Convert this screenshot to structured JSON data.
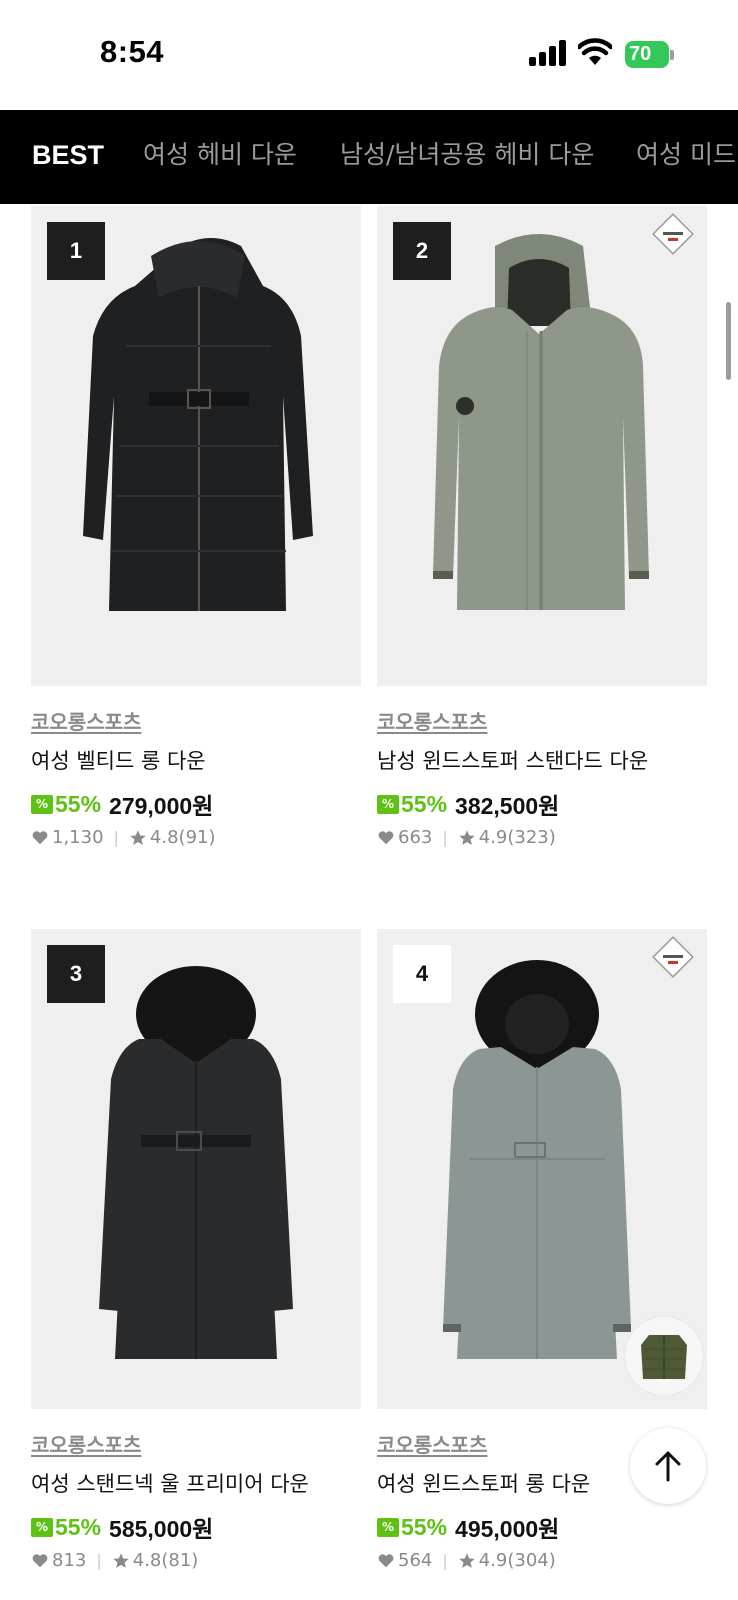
{
  "status_bar": {
    "time": "8:54",
    "battery": "70"
  },
  "tabs": [
    {
      "label": "BEST",
      "active": true
    },
    {
      "label": "여성 헤비 다운",
      "active": false
    },
    {
      "label": "남성/남녀공용 헤비 다운",
      "active": false
    },
    {
      "label": "여성 미드,",
      "active": false
    }
  ],
  "products": [
    {
      "rank": "1",
      "brand": "코오롱스포츠",
      "name": "여성 벨티드 롱 다운",
      "discount": "55%",
      "price": "279,000원",
      "likes": "1,130",
      "rating": "4.8(91)",
      "coat_color": "#1f2022"
    },
    {
      "rank": "2",
      "brand": "코오롱스포츠",
      "name": "남성 윈드스토퍼 스탠다드 다운",
      "discount": "55%",
      "price": "382,500원",
      "likes": "663",
      "rating": "4.9(323)",
      "coat_color": "#8f978a"
    },
    {
      "rank": "3",
      "brand": "코오롱스포츠",
      "name": "여성 스탠드넥 울 프리미어 다운",
      "discount": "55%",
      "price": "585,000원",
      "likes": "813",
      "rating": "4.8(81)",
      "coat_color": "#2a2b2d"
    },
    {
      "rank": "4",
      "brand": "코오롱스포츠",
      "name": "여성 윈드스토퍼 롱 다운",
      "discount": "55%",
      "price": "495,000원",
      "likes": "564",
      "rating": "4.9(304)",
      "coat_color": "#8c9694"
    }
  ],
  "icons": {
    "sale": "sale-percent-icon",
    "likes": "heart-icon",
    "rating": "star-icon",
    "top": "arrow-up-icon"
  },
  "colors": {
    "accent": "#5ec214",
    "tab_bar": "#000000"
  }
}
